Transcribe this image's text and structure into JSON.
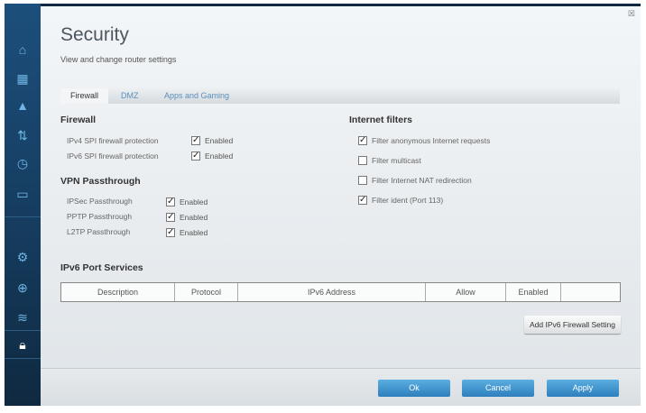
{
  "header": {
    "title": "Security",
    "subtitle": "View and change router settings",
    "close": "☒"
  },
  "tabs": [
    {
      "label": "Firewall",
      "active": true
    },
    {
      "label": "DMZ"
    },
    {
      "label": "Apps and Gaming"
    }
  ],
  "firewall": {
    "heading": "Firewall",
    "items": [
      {
        "label": "IPv4 SPI firewall protection",
        "value": "Enabled",
        "checked": true
      },
      {
        "label": "IPv6 SPI firewall protection",
        "value": "Enabled",
        "checked": true
      }
    ]
  },
  "vpn": {
    "heading": "VPN Passthrough",
    "items": [
      {
        "label": "IPSec Passthrough",
        "value": "Enabled",
        "checked": true
      },
      {
        "label": "PPTP Passthrough",
        "value": "Enabled",
        "checked": true
      },
      {
        "label": "L2TP Passthrough",
        "value": "Enabled",
        "checked": true
      }
    ]
  },
  "filters": {
    "heading": "Internet filters",
    "items": [
      {
        "label": "Filter anonymous Internet requests",
        "checked": true
      },
      {
        "label": "Filter multicast",
        "checked": false
      },
      {
        "label": "Filter Internet NAT redirection",
        "checked": false
      },
      {
        "label": "Filter ident (Port 113)",
        "checked": true
      }
    ]
  },
  "ipv6": {
    "heading": "IPv6 Port Services",
    "columns": [
      "Description",
      "Protocol",
      "IPv6 Address",
      "Allow",
      "Enabled",
      ""
    ],
    "add_button": "Add IPv6 Firewall Setting"
  },
  "footer": {
    "ok": "Ok",
    "cancel": "Cancel",
    "apply": "Apply"
  },
  "sidebar": [
    "router-icon",
    "calendar-icon",
    "warning-icon",
    "priority-icon",
    "clock-icon",
    "network-icon",
    "gear-icon",
    "toolbox-icon",
    "wifi-icon",
    "security-icon"
  ]
}
